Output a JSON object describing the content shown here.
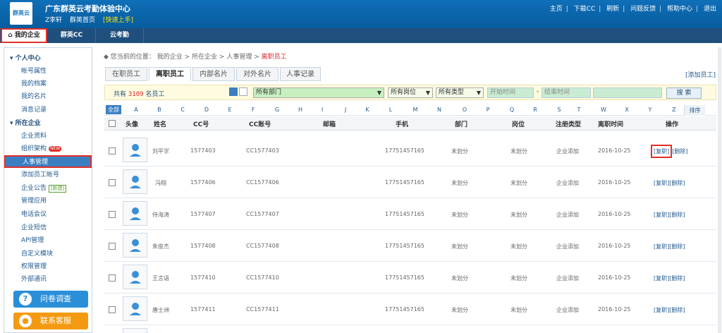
{
  "header": {
    "org_name": "广东群英云考勤体验中心",
    "user": "Z李轩",
    "home_link": "群英首页",
    "quick_start": "[快速上手]",
    "logo_text": "群英云",
    "links": [
      "主页",
      "下载CC",
      "刷新",
      "问题反馈",
      "帮助中心",
      "退出"
    ]
  },
  "nav": {
    "tabs": [
      "我的企业",
      "群英CC",
      "云考勤"
    ]
  },
  "sidebar": {
    "groups": [
      {
        "title": "个人中心",
        "items": [
          "帐号属性",
          "我的档案",
          "我的名片",
          "消息记录"
        ]
      },
      {
        "title": "所在企业",
        "items": [
          "企业资料",
          "组织架构",
          "人事管理",
          "添加员工帐号",
          "企业公告",
          "管理应用",
          "电话会议",
          "企业短信",
          "API管理",
          "自定义模块",
          "权限管理",
          "外部通讯"
        ]
      }
    ],
    "new_badge": "NEW",
    "xin_badge": "[新建]",
    "survey_button": "问卷调查",
    "service_button": "联系客服"
  },
  "breadcrumb": {
    "prefix": "您当前的位置：",
    "items": [
      "我的企业",
      "所在企业",
      "人事管理"
    ],
    "current": "离职员工",
    "sep": ">"
  },
  "tabs": [
    "在职员工",
    "离职员工",
    "内部名片",
    "对外名片",
    "人事记录"
  ],
  "add_employee": "[添加员工]",
  "filter": {
    "total_prefix": "共有",
    "total_count": "3109",
    "total_suffix": "名员工",
    "dept": "所有部门",
    "post": "所有岗位",
    "type": "所有类型",
    "start_placeholder": "开始时间",
    "end_placeholder": "结束时间",
    "dash": "-",
    "search_button": "搜 索"
  },
  "letters": {
    "all": "全部",
    "items": [
      "A",
      "B",
      "C",
      "D",
      "E",
      "F",
      "G",
      "H",
      "I",
      "J",
      "K",
      "L",
      "M",
      "N",
      "O",
      "P",
      "Q",
      "R",
      "S",
      "T",
      "W",
      "X",
      "Y",
      "Z"
    ],
    "sort": "排序"
  },
  "table": {
    "headers": [
      "头像",
      "姓名",
      "CC号",
      "CC账号",
      "邮箱",
      "手机",
      "部门",
      "岗位",
      "注册类型",
      "离职时间",
      "操作"
    ],
    "rows": [
      {
        "name": "刘平学",
        "cc": "1577403",
        "account": "CC1577403",
        "email": "",
        "phone": "17751457165",
        "dept": "未划分",
        "post": "未划分",
        "reg": "企业添加",
        "date": "2016-10-25",
        "op1": "[复职]",
        "op2": "[删除]"
      },
      {
        "name": "冯翔",
        "cc": "1577406",
        "account": "CC1577406",
        "email": "",
        "phone": "17751457165",
        "dept": "未划分",
        "post": "未划分",
        "reg": "企业添加",
        "date": "2016-10-25",
        "op1": "[复职]",
        "op2": "[删除]"
      },
      {
        "name": "侍海涛",
        "cc": "1577407",
        "account": "CC1577407",
        "email": "",
        "phone": "17751457165",
        "dept": "未划分",
        "post": "未划分",
        "reg": "企业添加",
        "date": "2016-10-25",
        "op1": "[复职]",
        "op2": "[删除]"
      },
      {
        "name": "朱俊杰",
        "cc": "1577408",
        "account": "CC1577408",
        "email": "",
        "phone": "17751457165",
        "dept": "未划分",
        "post": "未划分",
        "reg": "企业添加",
        "date": "2016-10-25",
        "op1": "[复职]",
        "op2": "[删除]"
      },
      {
        "name": "王言语",
        "cc": "1577410",
        "account": "CC1577410",
        "email": "",
        "phone": "17751457165",
        "dept": "未划分",
        "post": "未划分",
        "reg": "企业添加",
        "date": "2016-10-25",
        "op1": "[复职]",
        "op2": "[删除]"
      },
      {
        "name": "唐士洲",
        "cc": "1577411",
        "account": "CC1577411",
        "email": "",
        "phone": "17751457165",
        "dept": "未划分",
        "post": "未划分",
        "reg": "企业添加",
        "date": "2016-10-25",
        "op1": "[复职]",
        "op2": "[删除]"
      }
    ]
  },
  "colors": {
    "brand": "#0f6fb8",
    "nav": "#1f4f7c",
    "highlight": "#e0302a",
    "survey": "#2b8fd8",
    "service": "#f39a12"
  }
}
